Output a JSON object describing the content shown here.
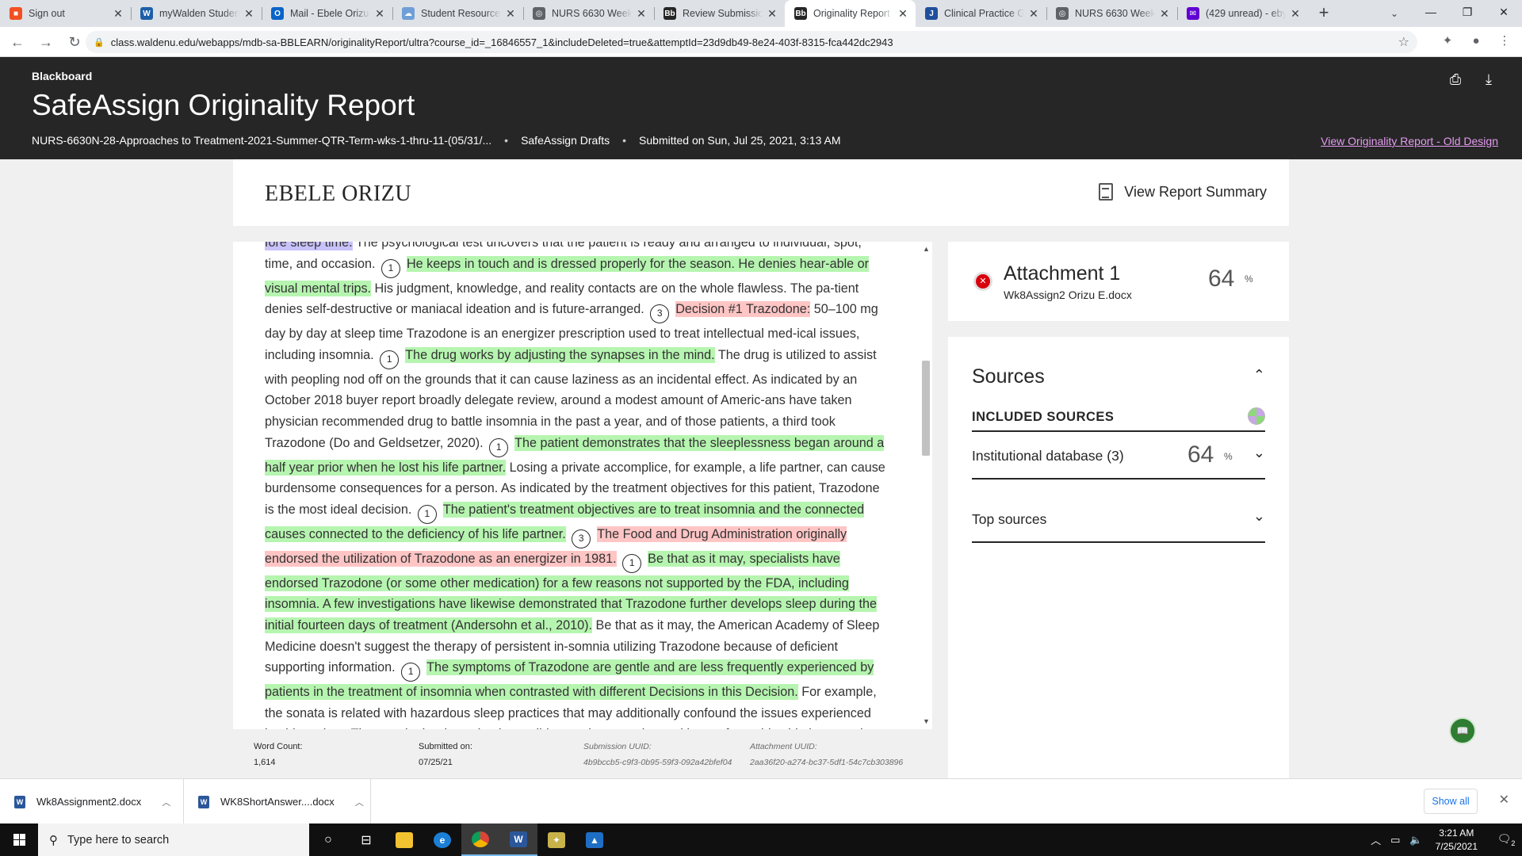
{
  "browser": {
    "tabs": [
      {
        "title": "Sign out",
        "icon": "microsoft-icon",
        "color": "#f25022",
        "glyph": "■",
        "active": false
      },
      {
        "title": "myWalden Student",
        "icon": "walden-w-icon",
        "color": "#1d5fa7",
        "glyph": "W",
        "active": false
      },
      {
        "title": "Mail - Ebele Orizu",
        "icon": "outlook-icon",
        "color": "#0a64c8",
        "glyph": "O",
        "active": false
      },
      {
        "title": "Student Resources",
        "icon": "cloud-icon",
        "color": "#6f9fd6",
        "glyph": "☁",
        "active": false
      },
      {
        "title": "NURS 6630 Week 8",
        "icon": "globe-icon",
        "color": "#5f6368",
        "glyph": "◎",
        "active": false
      },
      {
        "title": "Review Submission",
        "icon": "blackboard-icon",
        "color": "#262626",
        "glyph": "Bb",
        "active": false
      },
      {
        "title": "Originality Report",
        "icon": "blackboard-icon",
        "color": "#262626",
        "glyph": "Bb",
        "active": true
      },
      {
        "title": "Clinical Practice Gu",
        "icon": "journal-icon",
        "color": "#1f4f9c",
        "glyph": "J",
        "active": false
      },
      {
        "title": "NURS 6630 Week 8",
        "icon": "globe-icon",
        "color": "#5f6368",
        "glyph": "◎",
        "active": false
      },
      {
        "title": "(429 unread) - eby",
        "icon": "yahoo-mail-icon",
        "color": "#6001d2",
        "glyph": "✉",
        "active": false
      }
    ],
    "url": "class.waldenu.edu/webapps/mdb-sa-BBLEARN/originalityReport/ultra?course_id=_16846557_1&includeDeleted=true&attemptId=23d9db49-8e24-403f-8315-fca442dc2943"
  },
  "header": {
    "brand": "Blackboard",
    "title": "SafeAssign Originality Report",
    "course": "NURS-6630N-28-Approaches to Treatment-2021-Summer-QTR-Term-wks-1-thru-11-(05/31/...",
    "sep": "•",
    "drafts": "SafeAssign Drafts",
    "submitted": "Submitted on Sun, Jul 25, 2021, 3:13 AM",
    "old_design_link": "View Originality Report - Old Design"
  },
  "report": {
    "student_name": "EBELE ORIZU",
    "summary_button": "View Report Summary"
  },
  "document": {
    "segments": [
      {
        "t": "fore sleep time.",
        "hl": "top"
      },
      {
        "t": " The psychological test uncovers that the patient is ready and arranged to individual, spot, time, and occasion. "
      },
      {
        "m": "1"
      },
      {
        "t": "He keeps in touch and is dressed properly for the season. He denies hear-able or visual mental trips.",
        "hl": "1"
      },
      {
        "t": " His judgment, knowledge, and reality contacts are on the whole flawless. The pa-tient denies self-destructive or maniacal ideation and is future-arranged. "
      },
      {
        "m": "3"
      },
      {
        "t": "Decision #1 Trazodone:",
        "hl": "3"
      },
      {
        "t": " 50–100 mg day by day at sleep time Trazodone is an energizer prescription used to treat intellectual med-ical issues, including insomnia. "
      },
      {
        "m": "1"
      },
      {
        "t": "The drug works by adjusting the synapses in the mind.",
        "hl": "1"
      },
      {
        "t": " The drug is utilized to assist with peopling nod off on the grounds that it can cause laziness as an incidental effect. As indicated by an October 2018 buyer report broadly delegate review, around a modest amount of Americ-ans have taken physician recommended drug to battle insomnia in the past a year, and of those patients, a third took Trazodone (Do and Geldsetzer, 2020). "
      },
      {
        "m": "1"
      },
      {
        "t": "The patient demonstrates that the sleeplessness began around a half year prior when he lost his life partner.",
        "hl": "1"
      },
      {
        "t": " Losing a private accomplice, for example, a life partner, can cause burdensome consequences for a person. As indicated by the treatment objectives for this patient, Trazodone is the most ideal decision. "
      },
      {
        "m": "1"
      },
      {
        "t": "The patient's treatment objectives are to treat insomnia and the connected causes connected to the deficiency of his life partner.",
        "hl": "1"
      },
      {
        "t": " "
      },
      {
        "m": "3"
      },
      {
        "t": "The Food and Drug Administration originally endorsed the utilization of Trazodone as an energizer in 1981.",
        "hl": "3"
      },
      {
        "t": " "
      },
      {
        "m": "1"
      },
      {
        "t": "Be that as it may, specialists have endorsed Trazodone (or some other medication) for a few reasons not supported by the FDA, including insomnia. A few investigations have likewise demonstrated that Trazodone further develops sleep during the initial fourteen days of treatment (Andersohn et al., 2010).",
        "hl": "1"
      },
      {
        "t": " Be that as it may, the American Academy of Sleep Medicine doesn't suggest the therapy of persistent in-somnia utilizing Trazodone because of deficient supporting information. "
      },
      {
        "m": "1"
      },
      {
        "t": "The symptoms of Trazodone are gentle and are less frequently experienced by patients in the treatment of insomnia when contrasted with different Decisions in this Decision.",
        "hl": "1"
      },
      {
        "t": " For example, the sonata is related with hazardous sleep practices that may additionally confound the issues experienced by this patient. Then again, hy-droxyzine has solid narcotic properties and has unfavorable side impacts the following morning, which"
      }
    ],
    "footer": {
      "word_count_label": "Word Count:",
      "word_count": "1,614",
      "submitted_label": "Submitted on:",
      "submitted_date": "07/25/21",
      "submission_uuid_label": "Submission UUID:",
      "submission_uuid": "4b9bccb5-c9f3-0b95-59f3-092a42bfef04",
      "attachment_uuid_label": "Attachment UUID:",
      "attachment_uuid": "2aa36f20-a274-bc37-5df1-54c7cb303896"
    }
  },
  "attachment": {
    "title": "Attachment 1",
    "file": "Wk8Assign2 Orizu E.docx",
    "percent": "64",
    "percent_symbol": "%"
  },
  "sources": {
    "heading": "Sources",
    "included_label": "INCLUDED SOURCES",
    "institutional_label": "Institutional database (3)",
    "institutional_percent": "64",
    "percent_symbol": "%",
    "top_sources_label": "Top sources"
  },
  "downloads": {
    "items": [
      "Wk8Assignment2.docx",
      "WK8ShortAnswer....docx"
    ],
    "show_all": "Show all"
  },
  "taskbar": {
    "search_placeholder": "Type here to search",
    "time": "3:21 AM",
    "date": "7/25/2021",
    "notifications": "2"
  },
  "colors": {
    "match_source_1": "#b6f5b0",
    "match_source_3": "#ffc5c5",
    "match_other": "#c8c2fb",
    "header_bg": "#262626",
    "old_design_link": "#e49cf0"
  }
}
